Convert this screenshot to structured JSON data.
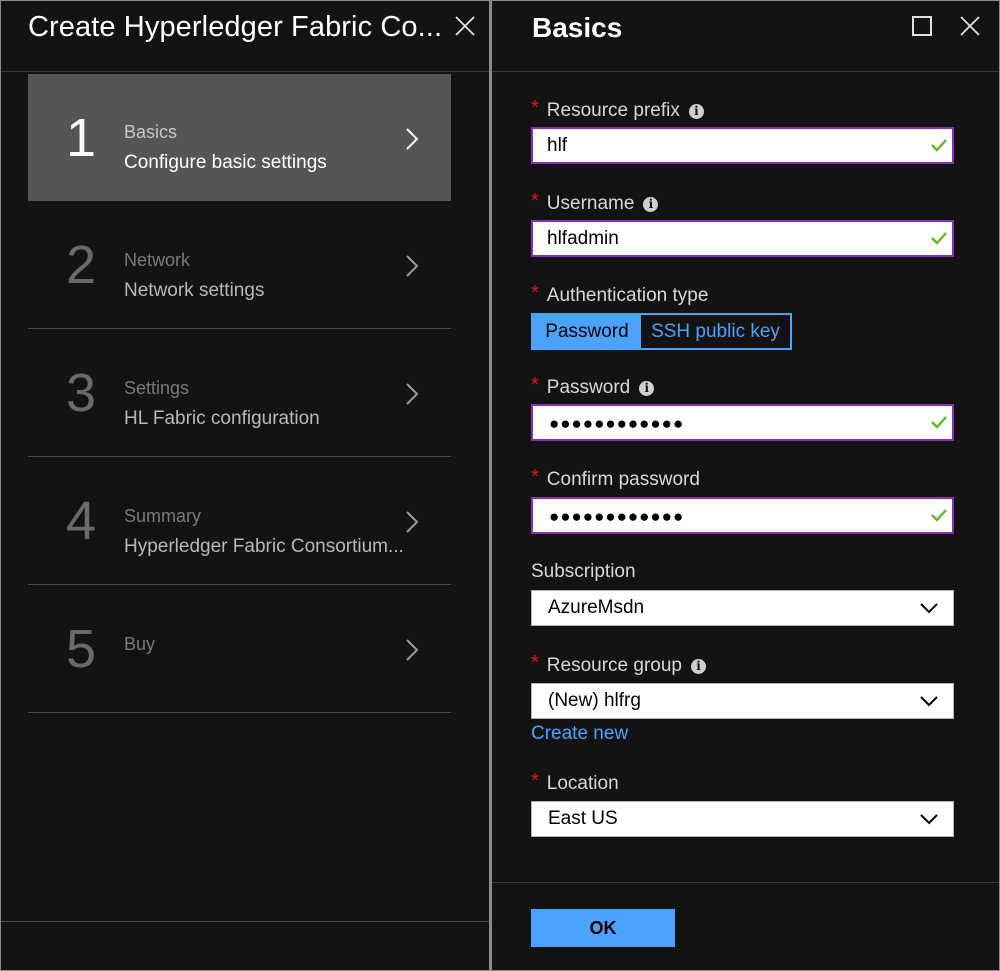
{
  "wizard": {
    "title": "Create Hyperledger Fabric Co...",
    "steps": [
      {
        "number": "1",
        "title": "Basics",
        "subtitle": "Configure basic settings",
        "active": true
      },
      {
        "number": "2",
        "title": "Network",
        "subtitle": "Network settings",
        "active": false
      },
      {
        "number": "3",
        "title": "Settings",
        "subtitle": "HL Fabric configuration",
        "active": false
      },
      {
        "number": "4",
        "title": "Summary",
        "subtitle": "Hyperledger Fabric Consortium...",
        "active": false
      },
      {
        "number": "5",
        "title": "Buy",
        "subtitle": "",
        "active": false
      }
    ]
  },
  "basics": {
    "title": "Basics",
    "resource_prefix": {
      "label": "Resource prefix",
      "value": "hlf"
    },
    "username": {
      "label": "Username",
      "value": "hlfadmin"
    },
    "auth_type": {
      "label": "Authentication type",
      "options": [
        "Password",
        "SSH public key"
      ],
      "selected": "Password"
    },
    "password": {
      "label": "Password",
      "value": "●●●●●●●●●●●●"
    },
    "confirm_password": {
      "label": "Confirm password",
      "value": "●●●●●●●●●●●●"
    },
    "subscription": {
      "label": "Subscription",
      "value": "AzureMsdn"
    },
    "resource_group": {
      "label": "Resource group",
      "value": "(New) hlfrg",
      "create_new": "Create new"
    },
    "location": {
      "label": "Location",
      "value": "East US"
    },
    "ok_label": "OK"
  },
  "colors": {
    "background": "#131313",
    "active_step": "#555555",
    "accent": "#4ba3ff",
    "valid_border": "#8c2fb8",
    "required": "#e81123",
    "check": "#5fb92a"
  }
}
